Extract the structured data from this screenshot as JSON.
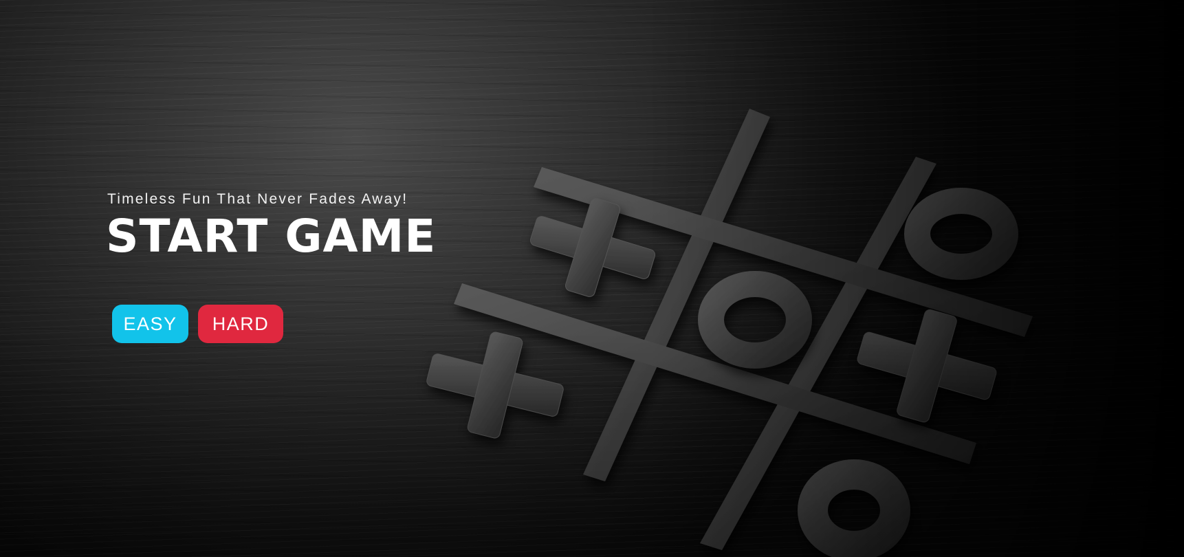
{
  "hero": {
    "tagline": "Timeless Fun That Never Fades Away!",
    "title": "START GAME"
  },
  "difficulty": {
    "easy_label": "EASY",
    "hard_label": "HARD"
  },
  "colors": {
    "easy": "#12c3ea",
    "hard": "#e0283f",
    "piece": "#3f3f3f"
  },
  "background_art": {
    "description_icon": "tic-tac-toe-board",
    "pieces": [
      "x",
      "x",
      "x",
      "o",
      "o",
      "o"
    ]
  }
}
